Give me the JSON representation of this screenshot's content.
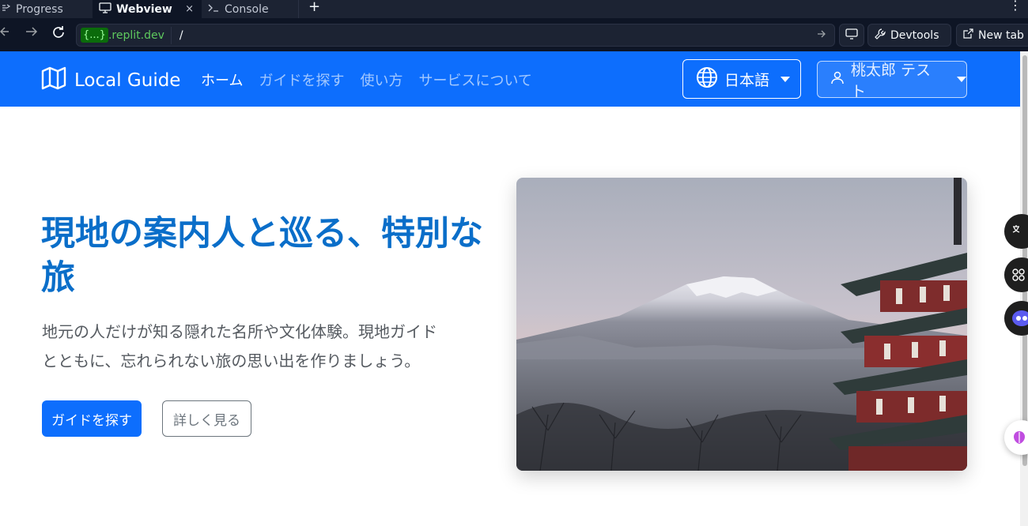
{
  "browser": {
    "tabs": [
      {
        "label": "Progress",
        "icon": "progress-icon"
      },
      {
        "label": "Webview",
        "icon": "monitor-icon",
        "close": "×"
      },
      {
        "label": "Console",
        "icon": "terminal-icon"
      }
    ],
    "add_tab": "+",
    "more": "⋮",
    "url_pill": "{...}",
    "url_host": ".replit.dev",
    "url_path": "/",
    "devtools_label": "Devtools",
    "newtab_label": "New tab"
  },
  "navbar": {
    "brand": "Local Guide",
    "links": [
      {
        "label": "ホーム",
        "active": true
      },
      {
        "label": "ガイドを探す",
        "active": false
      },
      {
        "label": "使い方",
        "active": false
      },
      {
        "label": "サービスについて",
        "active": false
      }
    ],
    "language": "日本語",
    "user": "桃太郎 テスト"
  },
  "hero": {
    "title_line1": "現地の案内人と巡る、特別な",
    "title_line2": "旅",
    "text_line1": "地元の人だけが知る隠れた名所や文化体験。現地ガイド",
    "text_line2": "とともに、忘れられない旅の思い出を作りましょう。",
    "primary_button": "ガイドを探す",
    "secondary_button": "詳しく見る"
  },
  "colors": {
    "primary": "#0d6efd",
    "title": "#0a6ec9",
    "chrome_bg": "#0e1525"
  }
}
